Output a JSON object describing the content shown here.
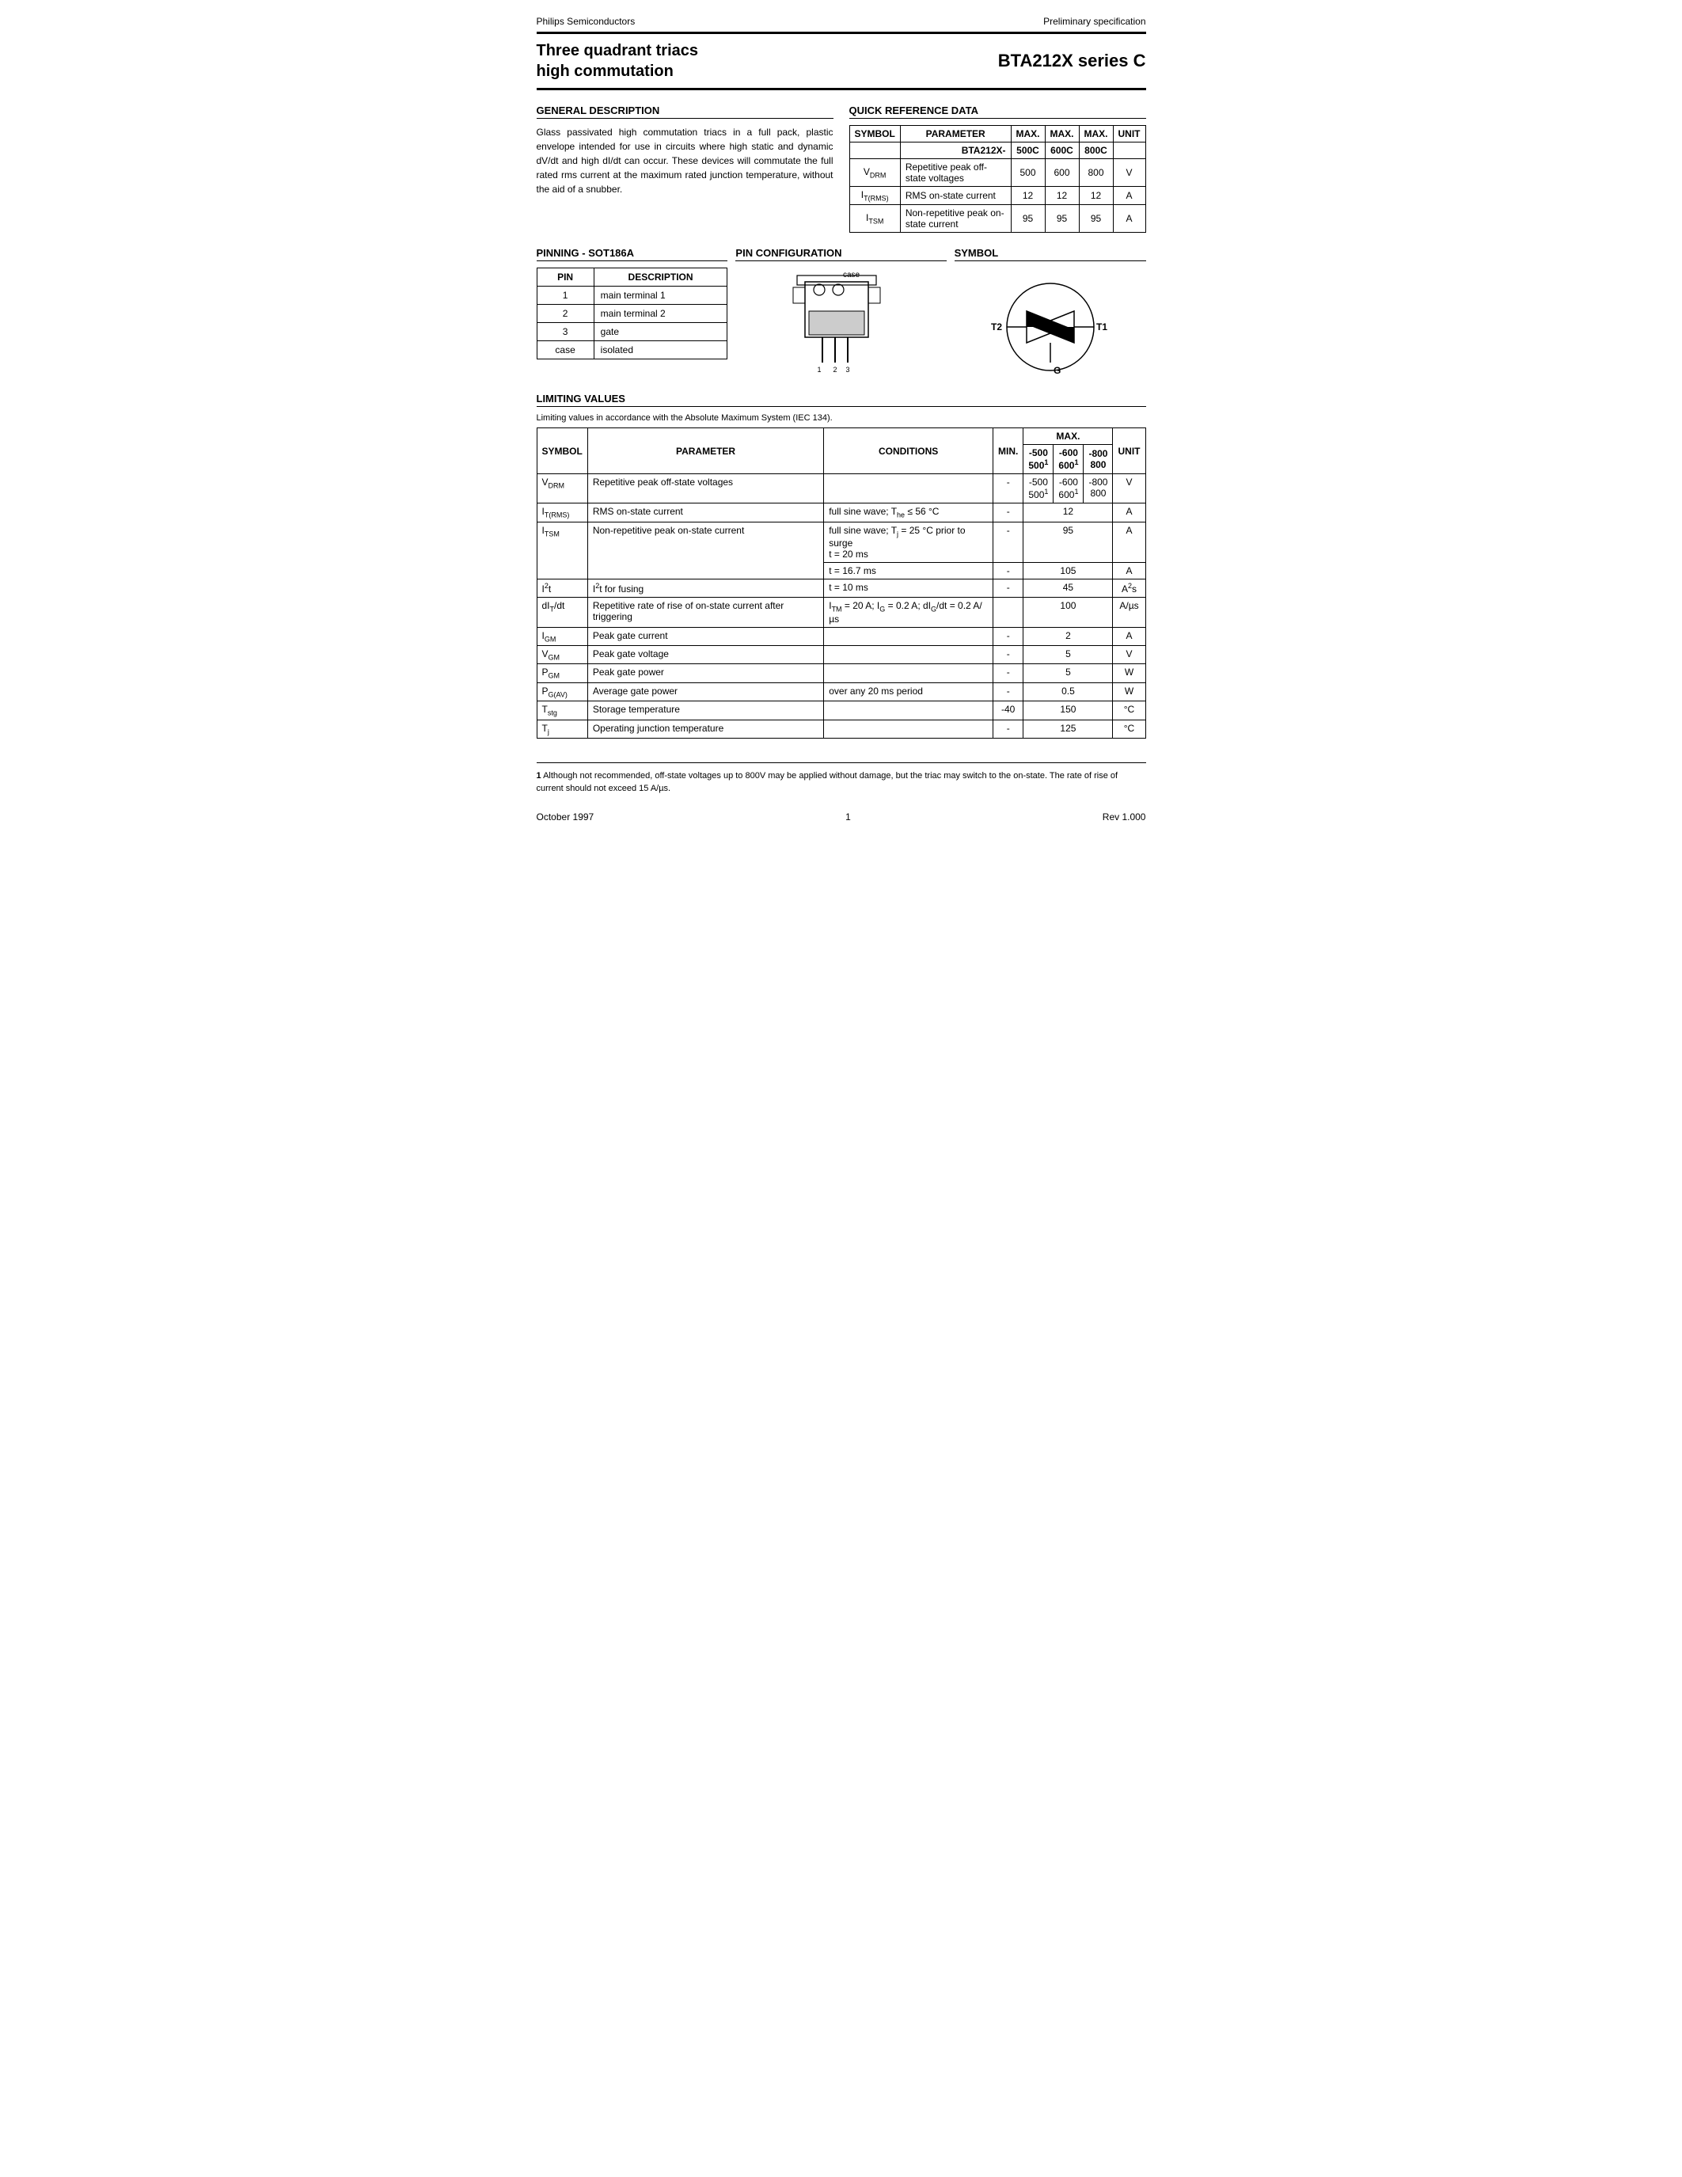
{
  "header": {
    "company": "Philips Semiconductors",
    "spec_type": "Preliminary specification",
    "title_left_line1": "Three quadrant triacs",
    "title_left_line2": "high commutation",
    "title_right": "BTA212X series C"
  },
  "general_description": {
    "section_title": "GENERAL DESCRIPTION",
    "text": "Glass passivated high commutation triacs in a full pack, plastic envelope intended for use in circuits where high static and dynamic dV/dt and high dI/dt can occur. These devices will commutate the full rated rms current at the maximum rated junction temperature, without the aid of a snubber."
  },
  "quick_reference": {
    "section_title": "QUICK REFERENCE DATA",
    "headers": [
      "SYMBOL",
      "PARAMETER",
      "MAX.",
      "MAX.",
      "MAX.",
      "UNIT"
    ],
    "subheader": [
      "",
      "BTA212X-",
      "500C",
      "600C",
      "800C",
      ""
    ],
    "rows": [
      [
        "V_DRM",
        "Repetitive peak off-state voltages",
        "500",
        "600",
        "800",
        "V"
      ],
      [
        "I_T(RMS)",
        "RMS on-state current",
        "12",
        "12",
        "12",
        "A"
      ],
      [
        "I_TSM",
        "Non-repetitive peak on-state current",
        "95",
        "95",
        "95",
        "A"
      ]
    ]
  },
  "pinning": {
    "section_title": "PINNING - SOT186A",
    "headers": [
      "PIN",
      "DESCRIPTION"
    ],
    "rows": [
      [
        "1",
        "main terminal 1"
      ],
      [
        "2",
        "main terminal 2"
      ],
      [
        "3",
        "gate"
      ],
      [
        "case",
        "isolated"
      ]
    ]
  },
  "pin_config": {
    "section_title": "PIN CONFIGURATION"
  },
  "symbol": {
    "section_title": "SYMBOL"
  },
  "limiting_values": {
    "section_title": "LIMITING VALUES",
    "note": "Limiting values in accordance with the Absolute Maximum System (IEC 134).",
    "headers": [
      "SYMBOL",
      "PARAMETER",
      "CONDITIONS",
      "MIN.",
      "MAX.",
      "UNIT"
    ],
    "max_subheaders": [
      "-500\n500¹",
      "-600\n600¹",
      "-800\n800"
    ],
    "rows": [
      {
        "symbol": "V_DRM",
        "parameter": "Repetitive peak off-state voltages",
        "conditions": "",
        "min": "-",
        "max_vals": [
          "-500\n500¹",
          "-600\n600¹",
          "-800\n800"
        ],
        "unit": "V"
      },
      {
        "symbol": "I_T(RMS)",
        "parameter": "RMS on-state current",
        "conditions": "full sine wave; T_he ≤ 56 °C",
        "min": "-",
        "max": "12",
        "unit": "A"
      },
      {
        "symbol": "I_TSM",
        "parameter": "Non-repetitive peak on-state current",
        "conditions": "full sine wave; T_j = 25 °C prior to surge",
        "min_vals": [
          "t = 20 ms",
          "t = 16.7 ms"
        ],
        "max_vals_tsm": [
          "95",
          "105"
        ],
        "unit_tsm": "A"
      },
      {
        "symbol": "I²t",
        "parameter": "I²t for fusing",
        "conditions": "t = 10 ms",
        "min": "-",
        "max": "45",
        "unit": "A²s"
      },
      {
        "symbol": "dI_T/dt",
        "parameter": "Repetitive rate of rise of on-state current after triggering",
        "conditions": "I_TM = 20 A; I_G = 0.2 A; dI_G/dt = 0.2 A/µs",
        "min": "",
        "max": "100",
        "unit": "A/µs"
      },
      {
        "symbol": "I_GM",
        "parameter": "Peak gate current",
        "conditions": "",
        "min": "-",
        "max": "2",
        "unit": "A"
      },
      {
        "symbol": "V_GM",
        "parameter": "Peak gate voltage",
        "conditions": "",
        "min": "-",
        "max": "5",
        "unit": "V"
      },
      {
        "symbol": "P_GM",
        "parameter": "Peak gate power",
        "conditions": "",
        "min": "-",
        "max": "5",
        "unit": "W"
      },
      {
        "symbol": "P_G(AV)",
        "parameter": "Average gate power",
        "conditions": "over any 20 ms period",
        "min": "-",
        "max": "0.5",
        "unit": "W"
      },
      {
        "symbol": "T_stg",
        "parameter": "Storage temperature",
        "conditions": "",
        "min": "-40",
        "max": "150",
        "unit": "°C"
      },
      {
        "symbol": "T_j",
        "parameter": "Operating junction temperature",
        "conditions": "",
        "min": "-",
        "max": "125",
        "unit": "°C"
      }
    ]
  },
  "footnote": {
    "number": "1",
    "text": "Although not recommended, off-state voltages up to 800V may be applied without damage, but the triac may switch to the on-state. The rate of rise of current should not exceed 15 A/µs."
  },
  "footer": {
    "date": "October 1997",
    "page": "1",
    "rev": "Rev 1.000"
  }
}
